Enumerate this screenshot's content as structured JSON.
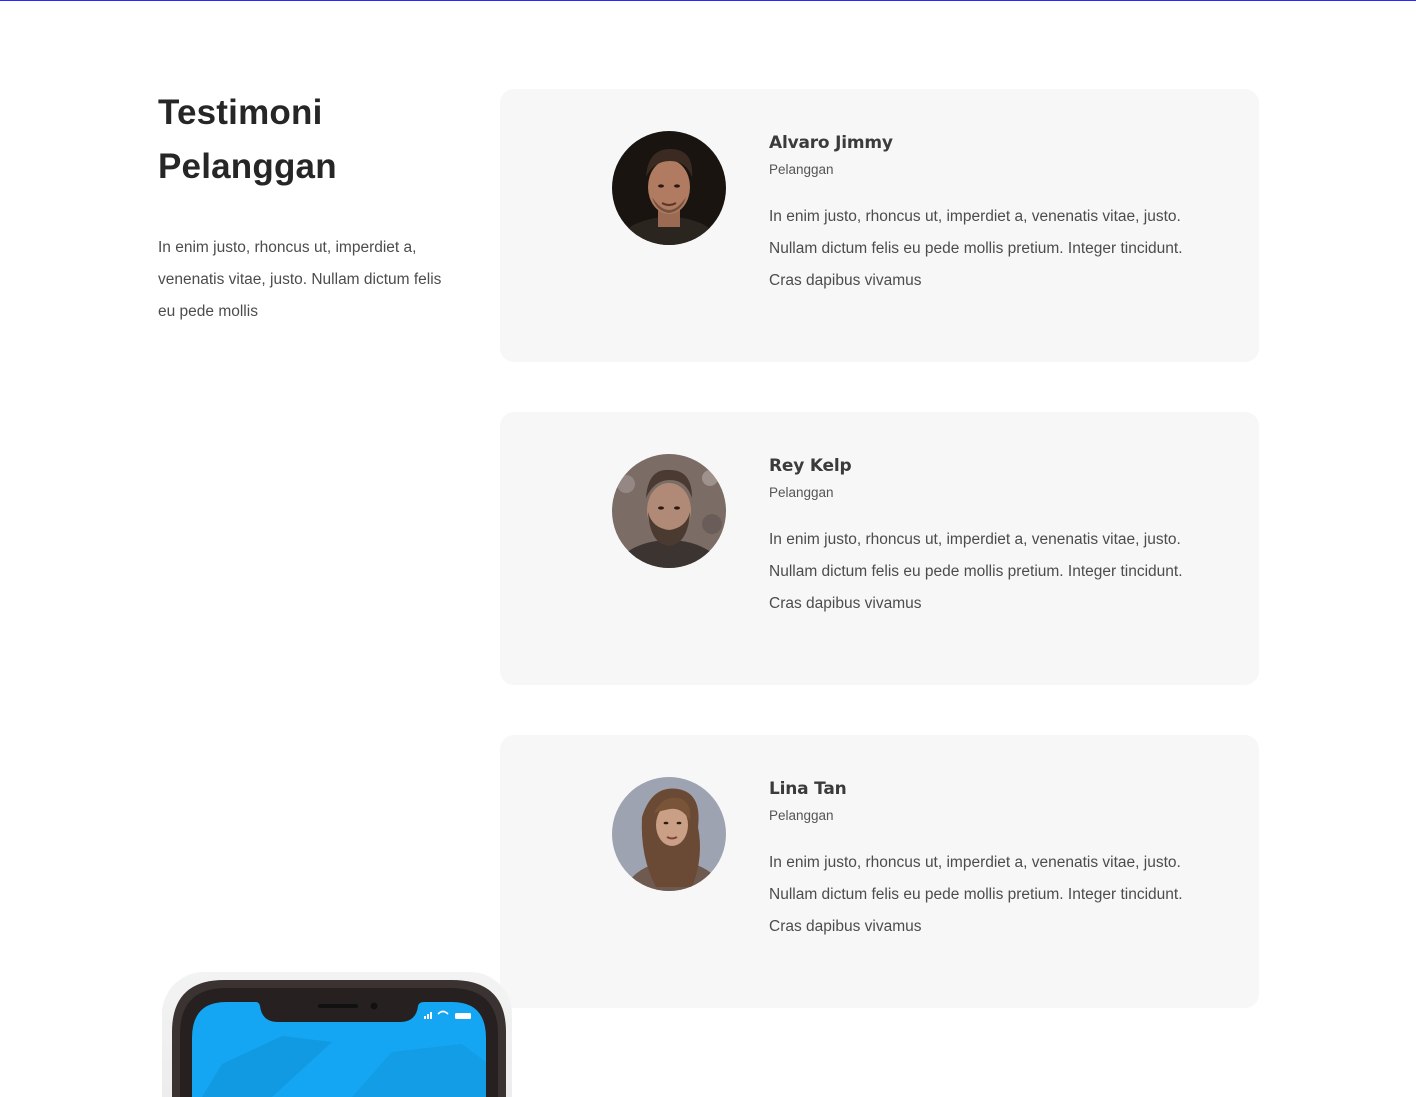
{
  "section": {
    "title_line1": "Testimoni",
    "title_line2": "Pelanggan",
    "description": "In enim justo, rhoncus ut, imperdiet a, venenatis vitae, justo. Nullam dictum felis eu pede mollis"
  },
  "testimonials": [
    {
      "name": "Alvaro Jimmy",
      "role": "Pelanggan",
      "quote": "In enim justo, rhoncus ut, imperdiet a, venenatis vitae, justo. Nullam dictum felis eu pede mollis pretium. Integer tincidunt. Cras dapibus vivamus",
      "avatar_icon": "man-portrait"
    },
    {
      "name": "Rey Kelp",
      "role": "Pelanggan",
      "quote": "In enim justo, rhoncus ut, imperdiet a, venenatis vitae, justo. Nullam dictum felis eu pede mollis pretium. Integer tincidunt. Cras dapibus vivamus",
      "avatar_icon": "bearded-man-portrait"
    },
    {
      "name": "Lina Tan",
      "role": "Pelanggan",
      "quote": "In enim justo, rhoncus ut, imperdiet a, venenatis vitae, justo. Nullam dictum felis eu pede mollis pretium. Integer tincidunt. Cras dapibus vivamus",
      "avatar_icon": "woman-portrait"
    }
  ],
  "colors": {
    "card_bg": "#f7f7f7",
    "heading": "#262626",
    "body_text": "#4c4c4c",
    "phone_screen": "#14a6f2"
  }
}
